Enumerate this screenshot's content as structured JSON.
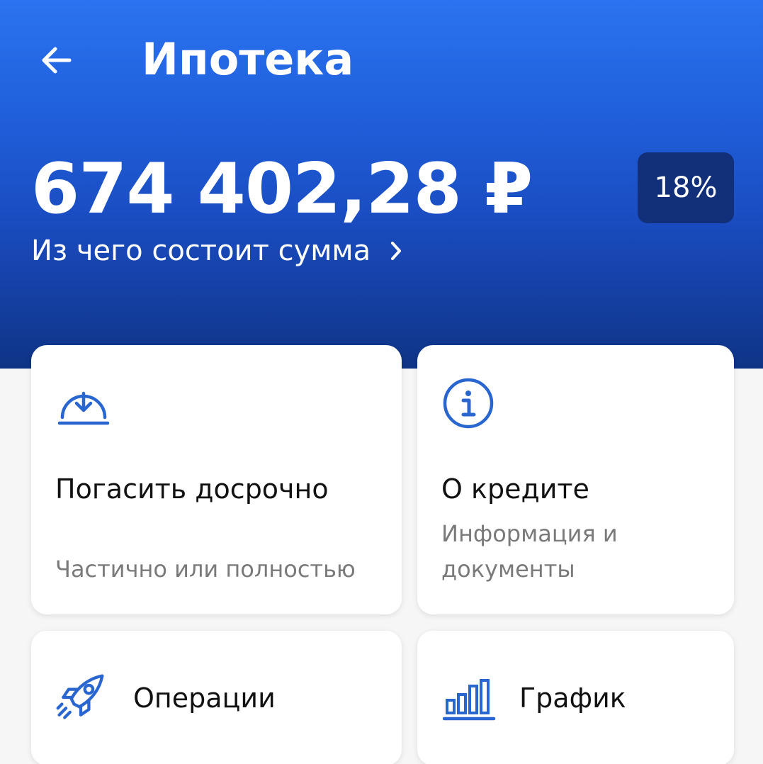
{
  "header": {
    "title": "Ипотека",
    "amount": "674 402,28 ₽",
    "rate_badge": "18%",
    "breakdown_link": "Из чего состоит сумма"
  },
  "cards": {
    "prepay": {
      "title": "Погасить досрочно",
      "subtitle": "Частично или полностью",
      "icon": "download-arc-icon"
    },
    "info": {
      "title": "О кредите",
      "subtitle_line1": "Информация и",
      "subtitle_line2": "документы",
      "icon": "info-icon"
    },
    "operations": {
      "title": "Операции",
      "icon": "rocket-icon"
    },
    "schedule": {
      "title": "График",
      "icon": "bar-chart-icon"
    }
  },
  "colors": {
    "header_gradient_top": "#2b73f0",
    "header_gradient_bottom": "#0f3486",
    "badge_bg": "#12307a",
    "icon_blue": "#2a66cf",
    "subtitle_gray": "#7a7a7a"
  }
}
